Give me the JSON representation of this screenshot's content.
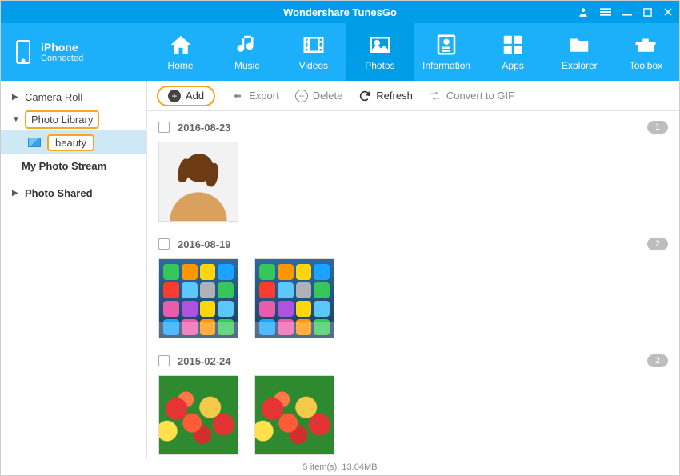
{
  "title": "Wondershare TunesGo",
  "device": {
    "name": "iPhone",
    "status": "Connected"
  },
  "tabs": {
    "home": "Home",
    "music": "Music",
    "videos": "Videos",
    "photos": "Photos",
    "information": "Information",
    "apps": "Apps",
    "explorer": "Explorer",
    "toolbox": "Toolbox"
  },
  "sidebar": {
    "camera_roll": "Camera Roll",
    "photo_library": "Photo Library",
    "beauty": "beauty",
    "my_photo_stream": "My Photo Stream",
    "photo_shared": "Photo Shared"
  },
  "toolbar": {
    "add": "Add",
    "export": "Export",
    "delete": "Delete",
    "refresh": "Refresh",
    "convert": "Convert to GIF"
  },
  "groups": [
    {
      "date": "2016-08-23",
      "count": "1"
    },
    {
      "date": "2016-08-19",
      "count": "2"
    },
    {
      "date": "2015-02-24",
      "count": "2"
    }
  ],
  "status": "5 item(s), 13.04MB",
  "iphone_icon_colors": [
    "#35c759",
    "#ff9500",
    "#ffd60a",
    "#1aa3ff",
    "#ff3b30",
    "#5ac8fa",
    "#aeb2b7",
    "#34c759",
    "#e85cad",
    "#af52de",
    "#ffd60a",
    "#5ac8fa",
    "#1aa3ff",
    "#e85cad",
    "#ff9500",
    "#34c759"
  ]
}
